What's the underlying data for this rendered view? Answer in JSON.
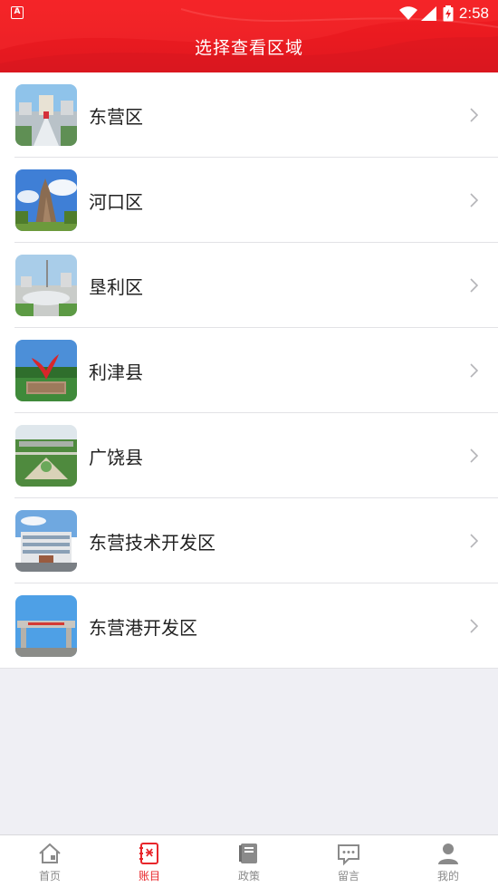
{
  "status_bar": {
    "app_badge": "A",
    "time": "2:58"
  },
  "header": {
    "title": "选择查看区域"
  },
  "regions": [
    {
      "label": "东营区",
      "thumb": "city-plaza"
    },
    {
      "label": "河口区",
      "thumb": "sculpture"
    },
    {
      "label": "垦利区",
      "thumb": "tower-park"
    },
    {
      "label": "利津县",
      "thumb": "phoenix-monument"
    },
    {
      "label": "广饶县",
      "thumb": "garden-aerial"
    },
    {
      "label": "东营技术开发区",
      "thumb": "office-building"
    },
    {
      "label": "东营港开发区",
      "thumb": "gate"
    }
  ],
  "tabbar": {
    "items": [
      {
        "label": "首页",
        "icon": "home-icon",
        "active": false
      },
      {
        "label": "账目",
        "icon": "ledger-icon",
        "active": true
      },
      {
        "label": "政策",
        "icon": "book-icon",
        "active": false
      },
      {
        "label": "留言",
        "icon": "message-icon",
        "active": false
      },
      {
        "label": "我的",
        "icon": "person-icon",
        "active": false
      }
    ]
  },
  "colors": {
    "brand_red": "#e91a20",
    "active_tab": "#e8262b",
    "inactive_tab": "#8a8a8a"
  }
}
